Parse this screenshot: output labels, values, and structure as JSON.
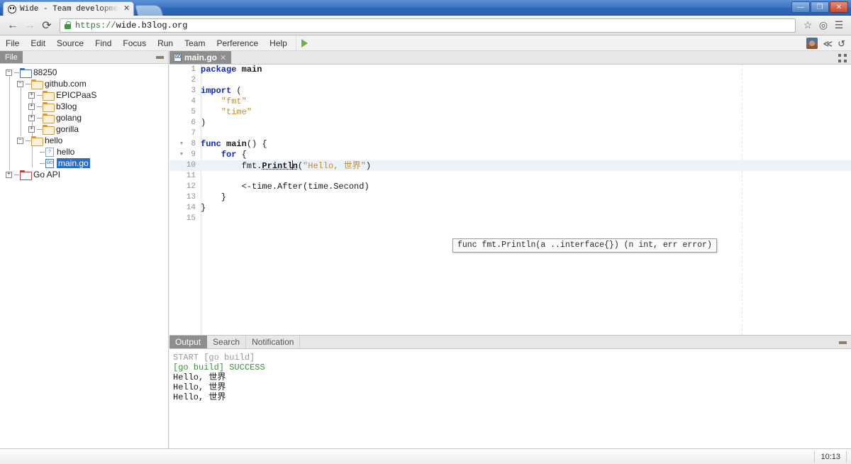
{
  "browser": {
    "tab_title": "Wide - Team development",
    "tab_close": "✕",
    "back_icon": "←",
    "forward_icon": "→",
    "reload_icon": "⟳",
    "url_scheme": "https://",
    "url_host": "wide.b3log.org",
    "bookmark_icon": "☆",
    "profile_icon": "◎",
    "menu_icon": "☰",
    "minimize_label": "—",
    "restore_label": "❐",
    "close_label": "✕"
  },
  "menubar": {
    "items": [
      {
        "label": "File"
      },
      {
        "label": "Edit"
      },
      {
        "label": "Source"
      },
      {
        "label": "Find"
      },
      {
        "label": "Focus"
      },
      {
        "label": "Run"
      },
      {
        "label": "Team"
      },
      {
        "label": "Perference"
      },
      {
        "label": "Help"
      }
    ],
    "run_icon": "run-triangle",
    "right_icons": {
      "avatar": "user-avatar",
      "share": "≪",
      "logout": "↺"
    }
  },
  "file_panel": {
    "tab_label": "File",
    "minimize_label": "—",
    "tree": [
      {
        "label": "88250",
        "depth": 0,
        "type": "folder-blue",
        "expander": "−",
        "selected": false
      },
      {
        "label": "github.com",
        "depth": 1,
        "type": "folder",
        "expander": "−",
        "selected": false
      },
      {
        "label": "EPICPaaS",
        "depth": 2,
        "type": "folder",
        "expander": "+",
        "selected": false
      },
      {
        "label": "b3log",
        "depth": 2,
        "type": "folder",
        "expander": "+",
        "selected": false
      },
      {
        "label": "golang",
        "depth": 2,
        "type": "folder",
        "expander": "+",
        "selected": false
      },
      {
        "label": "gorilla",
        "depth": 2,
        "type": "folder",
        "expander": "+",
        "selected": false
      },
      {
        "label": "hello",
        "depth": 1,
        "type": "folder",
        "expander": "−",
        "selected": false
      },
      {
        "label": "hello",
        "depth": 2,
        "type": "file",
        "expander": "",
        "selected": false
      },
      {
        "label": "main.go",
        "depth": 2,
        "type": "file-go",
        "expander": "",
        "selected": true
      },
      {
        "label": "Go API",
        "depth": 0,
        "type": "folder-red",
        "expander": "+",
        "selected": false
      }
    ]
  },
  "editor": {
    "tab": {
      "label": "main.go",
      "icon": "go-file-icon",
      "close": "✕"
    },
    "maximize_icon": "maximize-icon",
    "active_line": 10,
    "cursor_line": 10,
    "lines": [
      {
        "n": 1,
        "html": "<span class=\"kw\">package</span> <span class=\"fn\">main</span>"
      },
      {
        "n": 2,
        "html": ""
      },
      {
        "n": 3,
        "html": "<span class=\"kw\">import</span> ("
      },
      {
        "n": 4,
        "html": "    <span class=\"str\">\"fmt\"</span>"
      },
      {
        "n": 5,
        "html": "    <span class=\"str\">\"time\"</span>"
      },
      {
        "n": 6,
        "html": ")"
      },
      {
        "n": 7,
        "html": ""
      },
      {
        "n": 8,
        "html": "<span class=\"kw\">func</span> <span class=\"fn\">main</span>() {",
        "fold": true
      },
      {
        "n": 9,
        "html": "    <span class=\"kw\">for</span> {",
        "fold": true
      },
      {
        "n": 10,
        "html": "        fmt.<span class=\"mtd\">Printl</span><span class=\"caret\"></span><span class=\"mtd\">n</span>(<span class=\"str\">\"Hello, 世界\"</span>)"
      },
      {
        "n": 11,
        "html": ""
      },
      {
        "n": 12,
        "html": "        &lt;-time.After(time.Second)"
      },
      {
        "n": 13,
        "html": "    }"
      },
      {
        "n": 14,
        "html": "}"
      },
      {
        "n": 15,
        "html": ""
      }
    ],
    "tooltip": "func fmt.Println(a ..interface{}) (n int, err error)"
  },
  "output_panel": {
    "tabs": [
      {
        "label": "Output",
        "selected": true
      },
      {
        "label": "Search",
        "selected": false
      },
      {
        "label": "Notification",
        "selected": false
      }
    ],
    "minimize_label": "—",
    "log": [
      {
        "text": "START [go build]",
        "style": "muted"
      },
      {
        "text": "[go build] SUCCESS",
        "style": "ok"
      },
      {
        "text": "Hello, 世界",
        "style": "plain"
      },
      {
        "text": "Hello, 世界",
        "style": "plain"
      },
      {
        "text": "Hello, 世界",
        "style": "plain"
      }
    ]
  },
  "statusbar": {
    "clock": "10:13"
  },
  "colors": {
    "selection_blue": "#2a6ec9",
    "active_line": "#eaf2fb",
    "keyword": "#1226c4",
    "string": "#c38b2e",
    "success_green": "#3b8f3b",
    "panel_tab_gray": "#8e8e8e"
  }
}
